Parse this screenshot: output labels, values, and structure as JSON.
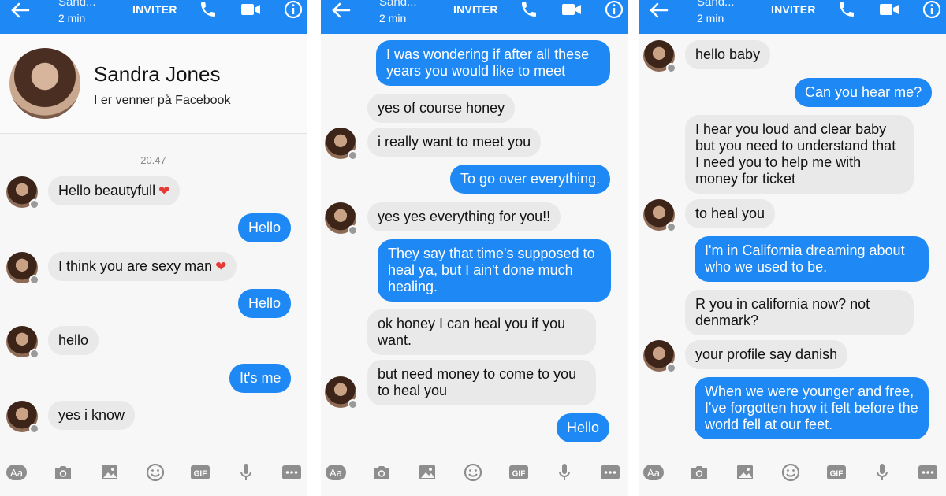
{
  "header": {
    "contact_name": "Sand...",
    "status": "2 min",
    "invite_label": "INVITER",
    "icons": [
      "back-arrow-icon",
      "phone-icon",
      "video-camera-icon",
      "info-icon"
    ],
    "color": "#1e88f5"
  },
  "profile": {
    "name": "Sandra Jones",
    "subtitle": "I er venner på Facebook"
  },
  "panel1": {
    "timestamp": "20.47",
    "messages": [
      {
        "dir": "in",
        "text": "Hello beautyfull"
      },
      {
        "dir": "out",
        "text": "Hello"
      },
      {
        "dir": "in",
        "text": "I think you are sexy man"
      },
      {
        "dir": "out",
        "text": "Hello"
      },
      {
        "dir": "in",
        "text": "hello"
      },
      {
        "dir": "out",
        "text": "It's me"
      },
      {
        "dir": "in",
        "text": "yes i know"
      }
    ]
  },
  "panel2": {
    "messages": [
      {
        "dir": "out",
        "text": "I was wondering if after all these years you would like to meet"
      },
      {
        "dir": "in",
        "text": "yes of course honey"
      },
      {
        "dir": "in",
        "text": "i really want to meet you"
      },
      {
        "dir": "out",
        "text": "To go over everything."
      },
      {
        "dir": "in",
        "text": "yes yes everything for you!!"
      },
      {
        "dir": "out",
        "text": "They say that time's supposed to heal ya, but I ain't done much healing."
      },
      {
        "dir": "in",
        "text": "ok honey I can heal you if you want."
      },
      {
        "dir": "in",
        "text": "but need money to come to you to heal you"
      },
      {
        "dir": "out",
        "text": "Hello"
      }
    ]
  },
  "panel3": {
    "messages": [
      {
        "dir": "in",
        "text": "hello baby"
      },
      {
        "dir": "out",
        "text": "Can you hear me?"
      },
      {
        "dir": "in",
        "text": "I hear you loud and clear baby but you need to understand that I need you to help me with money for ticket"
      },
      {
        "dir": "in",
        "text": "to heal you"
      },
      {
        "dir": "out",
        "text": "I'm in California dreaming about who we used to be."
      },
      {
        "dir": "in",
        "text": "R you in california now? not denmark?"
      },
      {
        "dir": "in",
        "text": "your profile say danish"
      },
      {
        "dir": "out",
        "text": "When we were younger and free, I've forgotten how it felt before the world fell at our feet."
      }
    ]
  },
  "toolbar": {
    "text_label": "Aa",
    "gif_label": "GIF",
    "icons": [
      "text-format-icon",
      "camera-icon",
      "image-icon",
      "emoji-icon",
      "gif-icon",
      "microphone-icon",
      "more-icon"
    ]
  }
}
